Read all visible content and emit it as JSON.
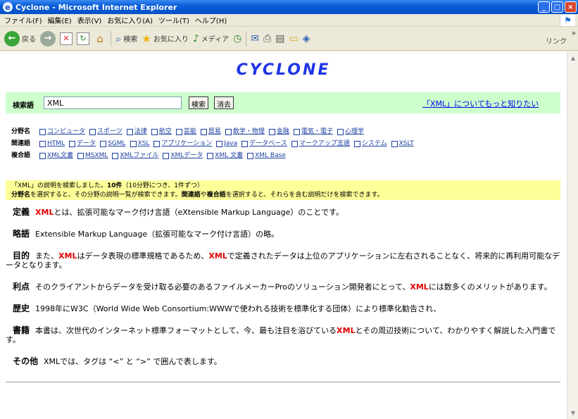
{
  "window": {
    "title": "Cyclone - Microsoft Internet Explorer",
    "ie_glyph": "e",
    "minimize_glyph": "_",
    "maximize_glyph": "□",
    "close_glyph": "×"
  },
  "menubar": {
    "items": [
      "ファイル(F)",
      "編集(E)",
      "表示(V)",
      "お気に入り(A)",
      "ツール(T)",
      "ヘルプ(H)"
    ],
    "windows_logo_glyph": "⚑"
  },
  "toolbar": {
    "back_label": "戻る",
    "back_glyph": "←",
    "forward_glyph": "→",
    "stop_glyph": "✕",
    "refresh_glyph": "↻",
    "home_glyph": "⌂",
    "search_label": "検索",
    "search_glyph": "⌕",
    "favorites_label": "お気に入り",
    "favorites_glyph": "★",
    "media_label": "メディア",
    "media_glyph": "♪",
    "history_glyph": "◷",
    "mail_glyph": "✉",
    "print_glyph": "⎙",
    "edit_glyph": "▤",
    "folder_glyph": "▭",
    "messenger_glyph": "◈",
    "links_label": "リンク",
    "chevron_glyph": "»"
  },
  "page": {
    "logo": "CYCLONE",
    "search": {
      "label": "検索語",
      "value": "XML",
      "submit_label": "検索",
      "clear_label": "消去",
      "more_link": "「XML」についてもっと知りたい"
    },
    "categories": [
      {
        "label": "分野名",
        "items": [
          "コンピュータ",
          "スポーツ",
          "法律",
          "航空",
          "芸能",
          "貿易",
          "数学・物理",
          "金融",
          "電気・電子",
          "心理学"
        ]
      },
      {
        "label": "関連語",
        "items": [
          "HTML",
          "データ",
          "SGML",
          "XSL",
          "アプリケーション",
          "Java",
          "データベース",
          "マークアップ言語",
          "システム",
          "XSLT"
        ]
      },
      {
        "label": "複合語",
        "items": [
          "XML文書",
          "MSXML",
          "XMLファイル",
          "XMLデータ",
          "XML 文書",
          "XML Base"
        ]
      }
    ],
    "notice": {
      "line1_pre": "「XML」の説明を検索しました。",
      "line1_count": "10件",
      "line1_post": "（10分野につき、1件ずつ）",
      "line2_b1": "分野名",
      "line2_t1": "を選択すると、その分野の説明一覧が検索できます。",
      "line2_b2": "関連語",
      "line2_t2": "や",
      "line2_b3": "複合語",
      "line2_t3": "を選択すると、それらを含む説明だけを検索できます。"
    },
    "entries": [
      {
        "label": "定義",
        "pre": "",
        "kw": "XML",
        "post": "とは、拡張可能なマーク付け言語（eXtensible Markup Language）のことです。",
        "kw2": "",
        "post2": ""
      },
      {
        "label": "略語",
        "pre": "Extensible Markup Language（拡張可能なマーク付け言語）の略。",
        "kw": "",
        "post": "",
        "kw2": "",
        "post2": ""
      },
      {
        "label": "目的",
        "pre": "また、",
        "kw": "XML",
        "post": "はデータ表現の標準規格であるため、",
        "kw2": "XML",
        "post2": "で定義されたデータは上位のアプリケーションに左右されることなく、将来的に再利用可能なデータとなります。"
      },
      {
        "label": "利点",
        "pre": "そのクライアントからデータを受け取る必要のあるファイルメーカーProのソリューション開発者にとって、",
        "kw": "XML",
        "post": "には数多くのメリットがあります。",
        "kw2": "",
        "post2": ""
      },
      {
        "label": "歴史",
        "pre": "1998年にW3C（World Wide Web Consortium:WWWで使われる技術を標準化する団体）により標準化勧告され、",
        "kw": "",
        "post": "",
        "kw2": "",
        "post2": ""
      },
      {
        "label": "書籍",
        "pre": "本書は、次世代のインターネット標準フォーマットとして、今、最も注目を浴びている",
        "kw": "XML",
        "post": "とその周辺技術について、わかりやすく解説した入門書です。",
        "kw2": "",
        "post2": ""
      },
      {
        "label": "その他",
        "pre": "XMLでは、タグは “<” と “>” で囲んで表します。",
        "kw": "",
        "post": "",
        "kw2": "",
        "post2": ""
      }
    ]
  },
  "scrollbar": {
    "up_glyph": "▲",
    "down_glyph": "▼"
  }
}
